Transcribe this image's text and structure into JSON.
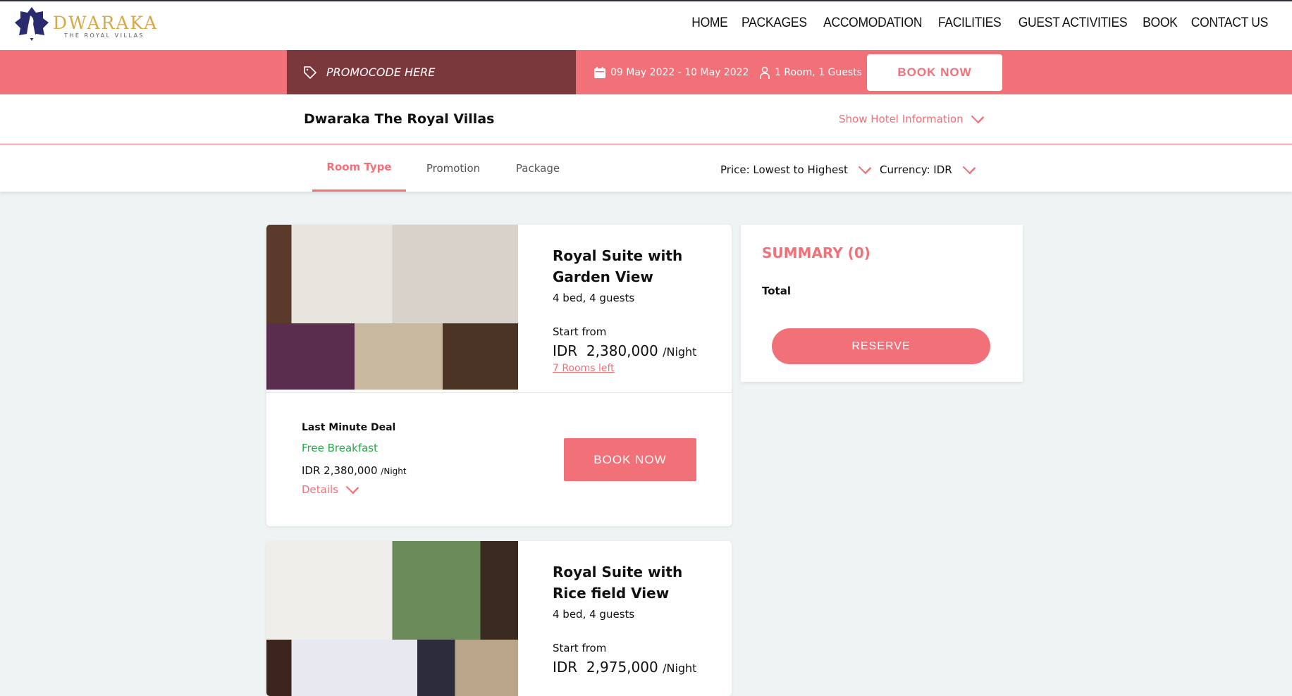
{
  "brand": {
    "name": "DWARAKA",
    "tagline": "THE ROYAL VILLAS"
  },
  "nav": [
    "HOME",
    "PACKAGES",
    "ACCOMODATION",
    "FACILITIES",
    "GUEST ACTIVITIES",
    "BOOK",
    "CONTACT US"
  ],
  "booking": {
    "promo_placeholder": "PROMOCODE HERE",
    "dates": "09 May 2022 - 10 May 2022",
    "guests": "1 Room, 1 Guests",
    "book_label": "BOOK NOW"
  },
  "hotel": {
    "name": "Dwaraka The Royal Villas",
    "show_info": "Show Hotel Information"
  },
  "tabs": [
    {
      "label": "Room Type",
      "active": true
    },
    {
      "label": "Promotion"
    },
    {
      "label": "Package"
    }
  ],
  "sort": "Price: Lowest to Highest",
  "currency": "Currency: IDR",
  "rooms": [
    {
      "title1": "Royal Suite with",
      "title2": "Garden View",
      "meta": "4 bed, 4 guests",
      "start": "Start from",
      "currency": "IDR",
      "price": "2,380,000",
      "per": "/Night",
      "left": "7 Rooms left",
      "deal": {
        "name": "Last Minute Deal",
        "perk": "Free Breakfast",
        "price": "IDR  2,380,000",
        "per": "/Night",
        "details": "Details",
        "book": "BOOK NOW"
      }
    },
    {
      "title1": "Royal Suite with",
      "title2": "Rice field View",
      "meta": "4 bed, 4 guests",
      "start": "Start from",
      "currency": "IDR",
      "price": "2,975,000",
      "per": "/Night"
    }
  ],
  "summary": {
    "title": "SUMMARY (0)",
    "total": "Total",
    "reserve": "RESERVE"
  },
  "colors": {
    "accent": "#f27078",
    "promo_bg": "#7a383c",
    "page_bg": "#eef3f3",
    "perk": "#2aa84a"
  }
}
